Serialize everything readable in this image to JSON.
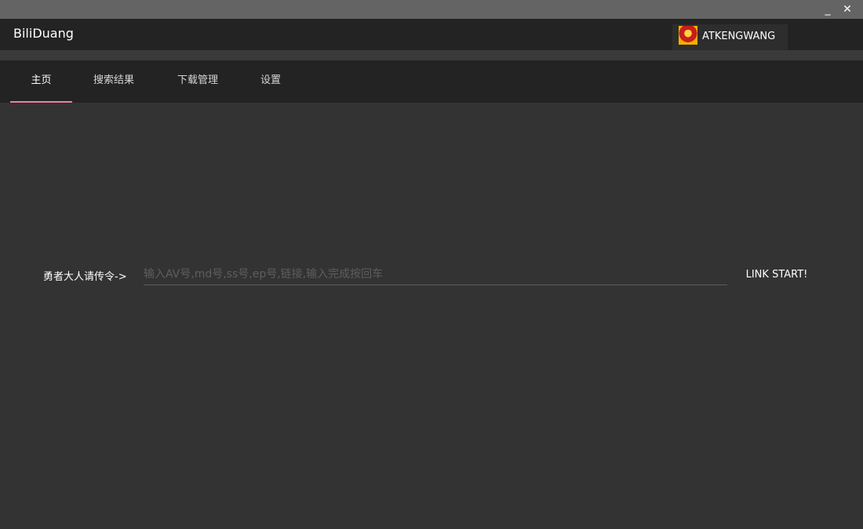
{
  "window": {
    "minimize_glyph": "_",
    "close_glyph": "✕"
  },
  "app": {
    "title": "BiliDuang"
  },
  "user": {
    "name": "ATKENGWANG",
    "avatar_icon": "avatar-icon"
  },
  "tabs": [
    {
      "label": "主页",
      "active": true
    },
    {
      "label": "搜索结果",
      "active": false
    },
    {
      "label": "下载管理",
      "active": false
    },
    {
      "label": "设置",
      "active": false
    }
  ],
  "command": {
    "label": "勇者大人请传令->",
    "placeholder": "输入AV号,md号,ss号,ep号,链接,输入完成按回车",
    "value": "",
    "button_label": "LINK START!"
  },
  "colors": {
    "accent": "#f07fa0",
    "background": "#333333",
    "bar": "#232323"
  }
}
